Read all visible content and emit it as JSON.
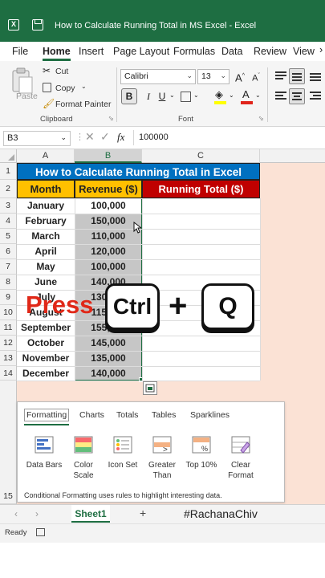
{
  "window": {
    "title": "How to Calculate Running Total in MS Excel  -  Excel",
    "accent": "#1e6e42"
  },
  "menu": {
    "tabs": [
      "File",
      "Home",
      "Insert",
      "Page Layout",
      "Formulas",
      "Data",
      "Review",
      "View"
    ],
    "active": "Home"
  },
  "ribbon": {
    "clipboard": {
      "paste": "Paste",
      "cut": "Cut",
      "copy": "Copy",
      "format_painter": "Format Painter",
      "group_label": "Clipboard"
    },
    "font": {
      "name": "Calibri",
      "size": "13",
      "bold": "B",
      "italic": "I",
      "underline": "U",
      "grow": "A",
      "shrink": "A",
      "highlight_letter": "A",
      "color_letter": "A",
      "group_label": "Font",
      "highlight_color": "#ffff00",
      "font_color": "#e0241b"
    }
  },
  "formula_bar": {
    "name_box": "B3",
    "fx": "fx",
    "value": "100000"
  },
  "columns": [
    "A",
    "B",
    "C"
  ],
  "rows": [
    "1",
    "2",
    "3",
    "4",
    "5",
    "6",
    "7",
    "8",
    "9",
    "10",
    "11",
    "12",
    "13",
    "14",
    "15"
  ],
  "sheet": {
    "title": "How to Calculate Running Total in Excel",
    "headers": {
      "month": "Month",
      "revenue": "Revenue ($)",
      "running": "Running Total ($)"
    },
    "data": [
      {
        "month": "January",
        "revenue": "100,000"
      },
      {
        "month": "February",
        "revenue": "150,000"
      },
      {
        "month": "March",
        "revenue": "110,000"
      },
      {
        "month": "April",
        "revenue": "120,000"
      },
      {
        "month": "May",
        "revenue": "100,000"
      },
      {
        "month": "June",
        "revenue": "140,000"
      },
      {
        "month": "July",
        "revenue": "130,000"
      },
      {
        "month": "August",
        "revenue": "115,000"
      },
      {
        "month": "September",
        "revenue": "155,000"
      },
      {
        "month": "October",
        "revenue": "145,000"
      },
      {
        "month": "November",
        "revenue": "135,000"
      },
      {
        "month": "December",
        "revenue": "140,000"
      }
    ],
    "colors": {
      "title_bg": "#0070c0",
      "month_header_bg": "#ffc000",
      "running_header_bg": "#c00000",
      "selection_bg": "#c6c6c6"
    }
  },
  "overlay": {
    "press": "Press",
    "key1": "Ctrl",
    "plus": "+",
    "key2": "Q"
  },
  "quick_analysis": {
    "tabs": [
      "Formatting",
      "Charts",
      "Totals",
      "Tables",
      "Sparklines"
    ],
    "active": "Formatting",
    "items": [
      {
        "label": "Data Bars",
        "icon": "data-bars-icon"
      },
      {
        "label": "Color Scale",
        "icon": "color-scale-icon"
      },
      {
        "label": "Icon Set",
        "icon": "icon-set-icon"
      },
      {
        "label": "Greater Than",
        "icon": "greater-than-icon"
      },
      {
        "label": "Top 10%",
        "icon": "top-10-icon"
      },
      {
        "label": "Clear Format",
        "icon": "clear-format-icon"
      }
    ],
    "description": "Conditional Formatting uses rules to highlight interesting data."
  },
  "sheet_tabs": {
    "active": "Sheet1",
    "add": "+",
    "watermark": "#RachanaChiv"
  },
  "status": {
    "ready": "Ready"
  }
}
